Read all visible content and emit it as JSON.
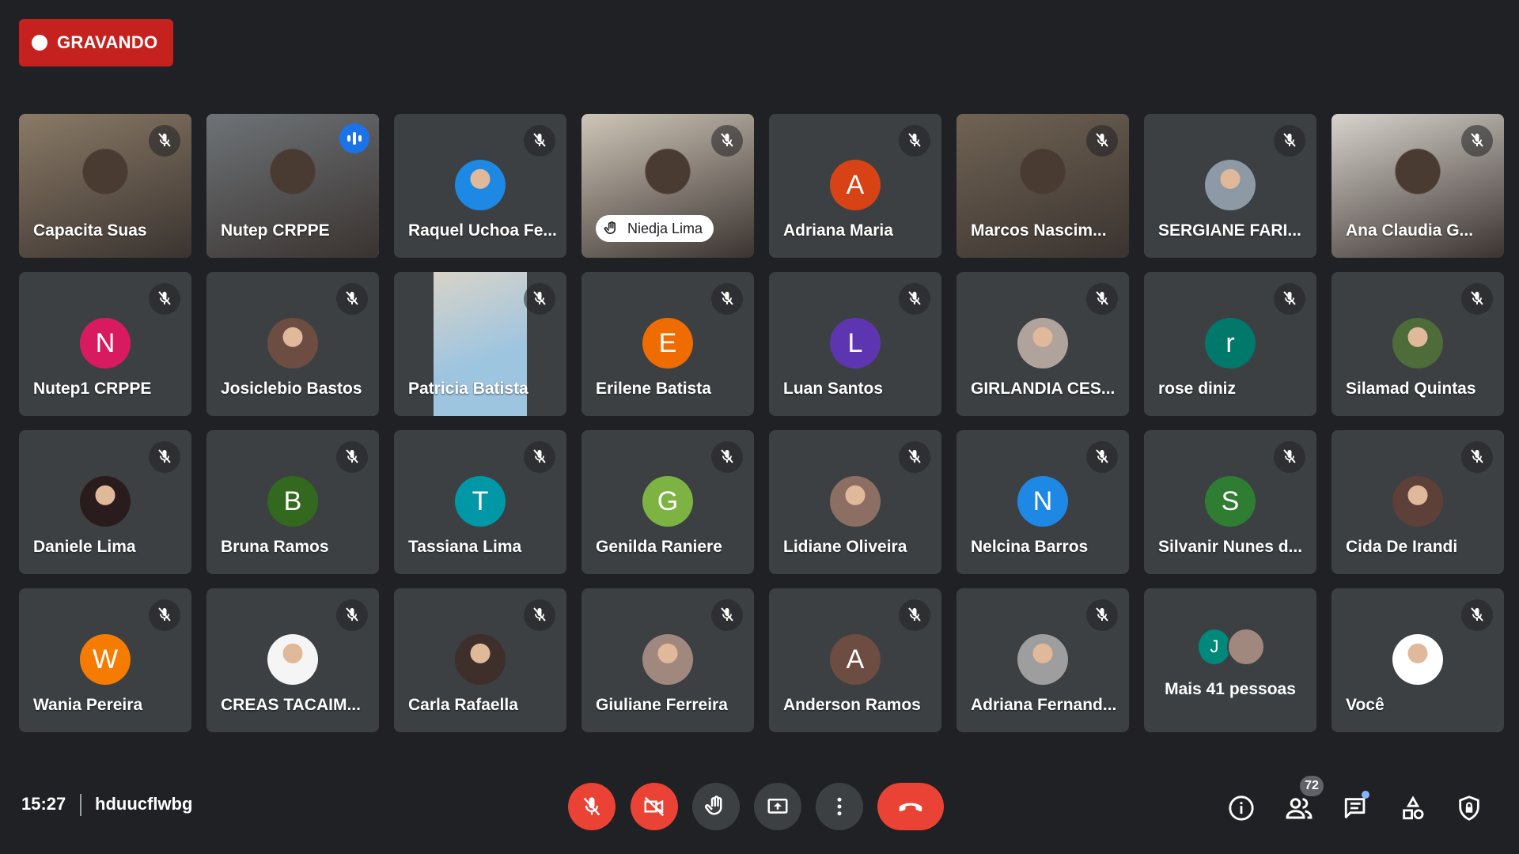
{
  "recording": {
    "label": "GRAVANDO"
  },
  "tiles": [
    {
      "name": "Capacita Suas",
      "type": "video",
      "bg": "#8a7a66"
    },
    {
      "name": "Nutep CRPPE",
      "type": "video",
      "bg": "#6e7377",
      "speaking": true
    },
    {
      "name": "Raquel Uchoa Fe...",
      "type": "photo",
      "avatar_bg": "#1e88e5"
    },
    {
      "name": "Niedja Lima",
      "type": "video",
      "bg": "#cfc6b8",
      "hand_raised": true
    },
    {
      "name": "Adriana Maria",
      "type": "initial",
      "initial": "A",
      "color": "#d84315"
    },
    {
      "name": "Marcos Nascim...",
      "type": "video",
      "bg": "#706353"
    },
    {
      "name": "SERGIANE FARI...",
      "type": "photo",
      "avatar_bg": "#8d9aa6"
    },
    {
      "name": "Ana Claudia G...",
      "type": "video",
      "bg": "#d9d3cd"
    },
    {
      "name": "Nutep1 CRPPE",
      "type": "initial",
      "initial": "N",
      "color": "#d81b60"
    },
    {
      "name": "Josiclebio Bastos",
      "type": "photo",
      "avatar_bg": "#6d4c41"
    },
    {
      "name": "Patricia Batista",
      "type": "video",
      "bg": "#9ec5e0",
      "narrow": true
    },
    {
      "name": "Erilene Batista",
      "type": "initial",
      "initial": "E",
      "color": "#ef6c00"
    },
    {
      "name": "Luan Santos",
      "type": "initial",
      "initial": "L",
      "color": "#5e35b1"
    },
    {
      "name": "GIRLANDIA CES...",
      "type": "photo",
      "avatar_bg": "#b0a39c"
    },
    {
      "name": "rose diniz",
      "type": "initial",
      "initial": "r",
      "color": "#00796b"
    },
    {
      "name": "Silamad Quintas",
      "type": "photo",
      "avatar_bg": "#4e6b3a"
    },
    {
      "name": "Daniele Lima",
      "type": "photo",
      "avatar_bg": "#2a1c1c"
    },
    {
      "name": "Bruna Ramos",
      "type": "initial",
      "initial": "B",
      "color": "#33691e"
    },
    {
      "name": "Tassiana Lima",
      "type": "initial",
      "initial": "T",
      "color": "#0097a7"
    },
    {
      "name": "Genilda Raniere",
      "type": "initial",
      "initial": "G",
      "color": "#7cb342"
    },
    {
      "name": "Lidiane Oliveira",
      "type": "photo",
      "avatar_bg": "#8d6e63"
    },
    {
      "name": "Nelcina Barros",
      "type": "initial",
      "initial": "N",
      "color": "#1e88e5"
    },
    {
      "name": "Silvanir Nunes d...",
      "type": "initial",
      "initial": "S",
      "color": "#2e7d32"
    },
    {
      "name": "Cida De Irandi",
      "type": "photo",
      "avatar_bg": "#5d4037"
    },
    {
      "name": "Wania Pereira",
      "type": "initial",
      "initial": "W",
      "color": "#f57c00"
    },
    {
      "name": "CREAS TACAIM...",
      "type": "photo",
      "avatar_bg": "#f5f5f5"
    },
    {
      "name": "Carla Rafaella",
      "type": "photo",
      "avatar_bg": "#3e2f2a"
    },
    {
      "name": "Giuliane Ferreira",
      "type": "photo",
      "avatar_bg": "#a1887f"
    },
    {
      "name": "Anderson Ramos",
      "type": "initial",
      "initial": "A",
      "color": "#6d4c41"
    },
    {
      "name": "Adriana Fernand...",
      "type": "photo",
      "avatar_bg": "#9e9e9e"
    },
    {
      "name": "Mais 41 pessoas",
      "type": "more",
      "initial": "J",
      "color": "#00897b"
    },
    {
      "name": "Você",
      "type": "photo",
      "avatar_bg": "#ffffff"
    }
  ],
  "bottom": {
    "time": "15:27",
    "meeting_code": "hduucflwbg",
    "participants_count": "72"
  }
}
